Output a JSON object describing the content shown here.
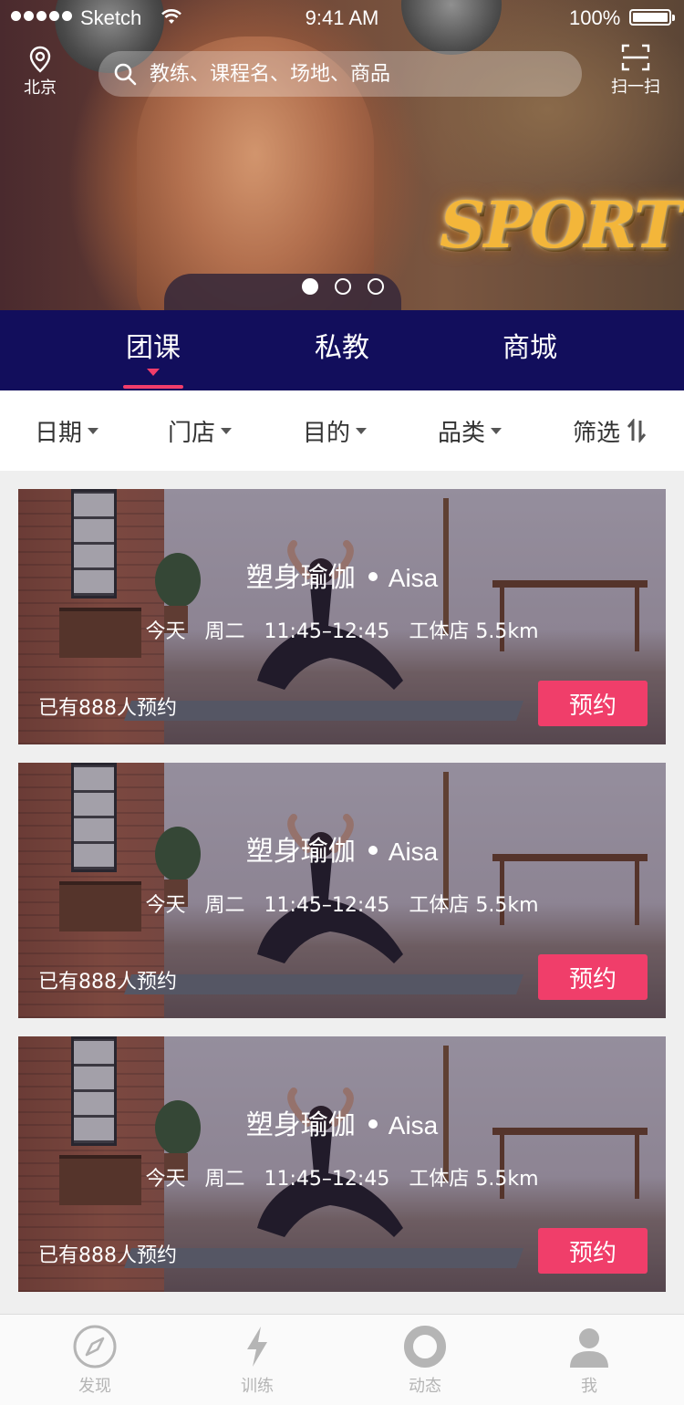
{
  "status_bar": {
    "carrier": "Sketch",
    "time": "9:41 AM",
    "battery": "100%"
  },
  "header": {
    "location_label": "北京",
    "search_placeholder": "教练、课程名、场地、商品",
    "scan_label": "扫一扫",
    "banner_text": "SPORT",
    "banner_page": 1,
    "banner_count": 3
  },
  "tabs": [
    {
      "label": "团课",
      "active": true
    },
    {
      "label": "私教",
      "active": false
    },
    {
      "label": "商城",
      "active": false
    }
  ],
  "filters": [
    {
      "label": "日期"
    },
    {
      "label": "门店"
    },
    {
      "label": "目的"
    },
    {
      "label": "品类"
    },
    {
      "label": "筛选"
    }
  ],
  "courses": [
    {
      "title": "塑身瑜伽",
      "coach": "Aisa",
      "day": "今天",
      "weekday": "周二",
      "time": "11:45–12:45",
      "venue": "工体店 5.5km",
      "booked": "已有888人预约",
      "button": "预约"
    },
    {
      "title": "塑身瑜伽",
      "coach": "Aisa",
      "day": "今天",
      "weekday": "周二",
      "time": "11:45–12:45",
      "venue": "工体店 5.5km",
      "booked": "已有888人预约",
      "button": "预约"
    },
    {
      "title": "塑身瑜伽",
      "coach": "Aisa",
      "day": "今天",
      "weekday": "周二",
      "time": "11:45–12:45",
      "venue": "工体店 5.5km",
      "booked": "已有888人预约",
      "button": "预约"
    }
  ],
  "bottom_nav": [
    {
      "label": "发现",
      "icon": "compass-icon"
    },
    {
      "label": "训练",
      "icon": "lightning-icon"
    },
    {
      "label": "动态",
      "icon": "ring-icon"
    },
    {
      "label": "我",
      "icon": "person-icon"
    }
  ],
  "colors": {
    "tab_bar": "#120e5c",
    "accent": "#f03e6a",
    "nav_inactive": "#b5b5b5"
  }
}
